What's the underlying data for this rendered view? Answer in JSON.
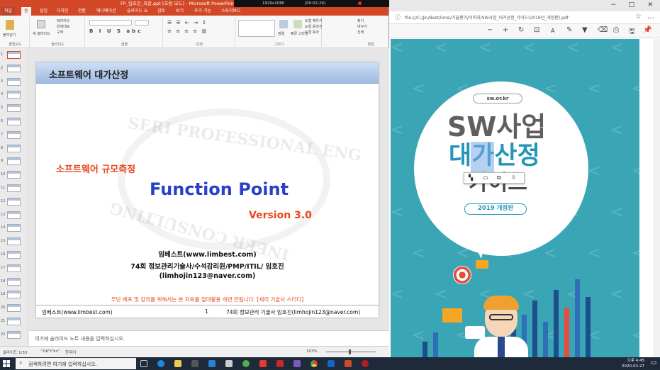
{
  "powerpoint": {
    "title": "FP_임호진_최종.ppt [호환 모드] - Microsoft PowerPoint",
    "recorder": {
      "resolution": "1920x1080",
      "elapsed": "[00:02:29]"
    },
    "tabs": [
      "파일",
      "홈",
      "삽입",
      "디자인",
      "전환",
      "애니메이션",
      "슬라이드 쇼",
      "검토",
      "보기",
      "추가 기능",
      "스토리보드"
    ],
    "ribbon_groups": [
      "클립보드",
      "슬라이드",
      "글꼴",
      "단락",
      "그리기",
      "편집"
    ],
    "ribbon_buttons": {
      "paste": "붙여넣기",
      "new_slide": "새 슬라이드",
      "layout": "레이아웃",
      "reset": "원래대로",
      "section": "구역",
      "arrange": "정렬",
      "quick_styles": "빠른 스타일",
      "shape_fill": "도형 채우기",
      "shape_outline": "도형 윤곽선",
      "shape_effects": "도형 효과",
      "find": "찾기",
      "replace": "바꾸기",
      "select": "선택"
    },
    "slide_numbers": [
      "1",
      "2",
      "3",
      "4",
      "5",
      "6",
      "7",
      "8",
      "9",
      "10",
      "11",
      "12",
      "13",
      "14",
      "15",
      "16",
      "17",
      "18",
      "19",
      "20",
      "21",
      "22"
    ],
    "slide": {
      "header": "소프트웨어 대가산정",
      "subheading": "소프트웨어 규모측정",
      "title": "Function Point",
      "version": "Version 3.0",
      "author_1": "임베스트(www.limbest.com)",
      "author_2": "74회 정보관리기술사/수석감리원/PMP/ITIL/ 임호진",
      "author_3": "(limhojin123@naver.com)",
      "notice": "무단 배포 및 강의를 위해서는 본 자료를 절대활용 하면 안됩니다. [세리 기술사 스터디]",
      "footer_left": "임베스트(www.limbest.com)",
      "footer_page": "1",
      "footer_right": "74회 정보관리 기술사 임호진(limhojin123@naver.com)",
      "watermark_top": "SERI PROFESSIONAL ENG",
      "watermark_bottom": "INEER CONSULTING"
    },
    "notes_placeholder": "여기에 슬라이드 노트 내용을 입력하십시오.",
    "status": {
      "slide_info": "슬라이드 1/33",
      "theme": "\"Ub\"t\"ks\"",
      "language": "한국어",
      "zoom": "103%"
    }
  },
  "pdf_viewer": {
    "url": "file:///C:/Jin/Best/limsi/기술평가/이미지/SW사업_대가산정_가이드(2019년_개정판).pdf",
    "page_sign": "",
    "cover": {
      "site": "sw.or.kr",
      "line1": "SW사업",
      "line2": "대가산정",
      "line3": "가이드",
      "edition": "2019 개정판"
    }
  },
  "taskbar": {
    "search_placeholder": "검색하려면 여기에 입력하십시오.",
    "time": "오후 4:45",
    "date": "2020-02-27"
  },
  "colors": {
    "ppt_accent": "#d24726",
    "slide_orange": "#e8471c",
    "slide_blue": "#2a40c8",
    "cover_teal": "#3aa5b5",
    "cover_blue": "#2694b8"
  }
}
